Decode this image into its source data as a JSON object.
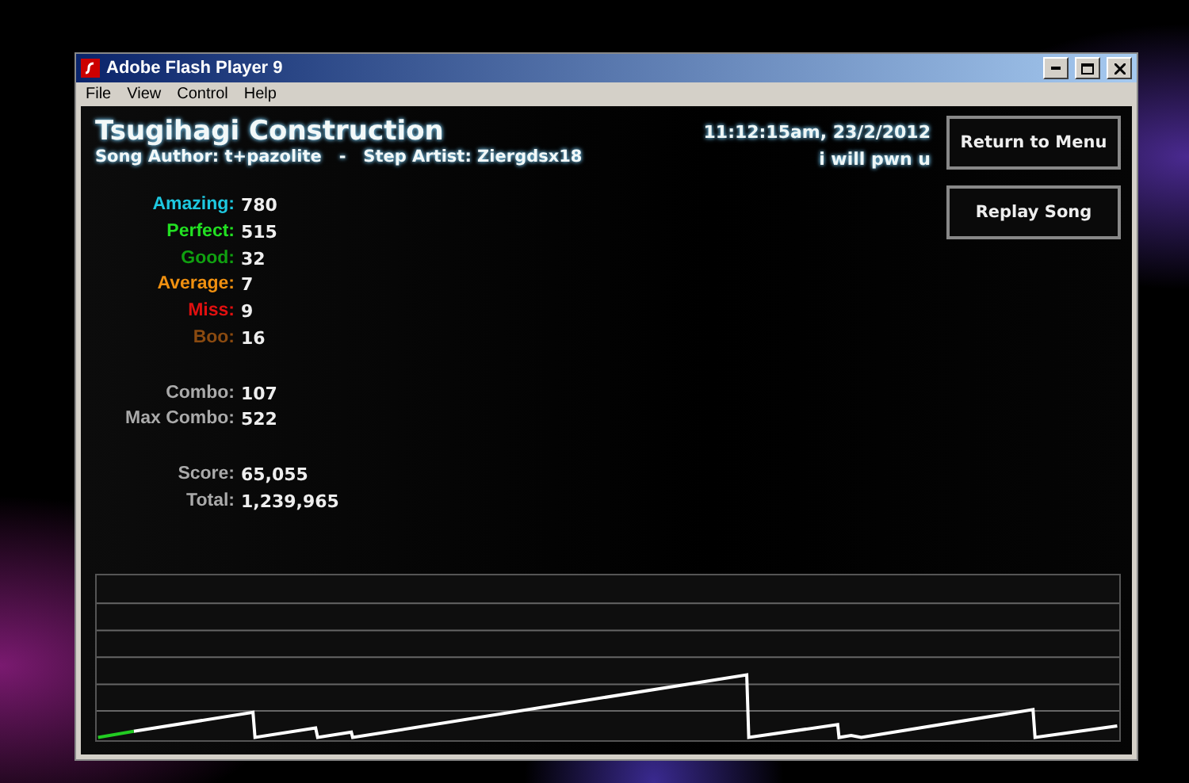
{
  "window": {
    "title": "Adobe Flash Player 9"
  },
  "menu": [
    "File",
    "View",
    "Control",
    "Help"
  ],
  "song": {
    "title": "Tsugihagi Construction",
    "author_line": "Song Author: t+pazolite   -   Step Artist: Ziergdsx18",
    "timestamp": "11:12:15am, 23/2/2012",
    "player": "i will pwn u"
  },
  "buttons": [
    "Return to Menu",
    "Replay Song"
  ],
  "judgements": [
    {
      "label": "Amazing:",
      "value": "780",
      "color": "#1ec8e0"
    },
    {
      "label": "Perfect:",
      "value": "515",
      "color": "#22e022"
    },
    {
      "label": "Good:",
      "value": "32",
      "color": "#10a010"
    },
    {
      "label": "Average:",
      "value": "7",
      "color": "#f09010"
    },
    {
      "label": "Miss:",
      "value": "9",
      "color": "#e01010"
    },
    {
      "label": "Boo:",
      "value": "16",
      "color": "#8a4a10"
    }
  ],
  "combo": [
    {
      "label": "Combo:",
      "value": "107"
    },
    {
      "label": "Max Combo:",
      "value": "522"
    }
  ],
  "score": [
    {
      "label": "Score:",
      "value": "65,055"
    },
    {
      "label": "Total:",
      "value": "1,239,965"
    }
  ]
}
